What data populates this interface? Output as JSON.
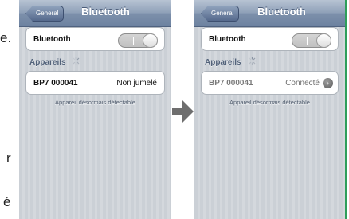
{
  "left_fragments": [
    "e.",
    "r",
    "é"
  ],
  "screens": [
    {
      "nav": {
        "back_label": "General",
        "title": "Bluetooth"
      },
      "bluetooth_row": {
        "label": "Bluetooth",
        "toggle_state": "on"
      },
      "devices_section": {
        "header": "Appareils"
      },
      "device": {
        "name": "BP7 000041",
        "status": "Non jumelé"
      },
      "footer_note": "Appareil désormais détectable"
    },
    {
      "nav": {
        "back_label": "General",
        "title": "Bluetooth"
      },
      "bluetooth_row": {
        "label": "Bluetooth",
        "toggle_state": "on"
      },
      "devices_section": {
        "header": "Appareils"
      },
      "device": {
        "name": "BP7 000041",
        "status": "Connecté",
        "info_icon": "chevron-right-icon"
      },
      "footer_note": "Appareil désormais détectable"
    }
  ],
  "arrow_icon": "arrow-right-icon",
  "colors": {
    "navbar": "#8d9fb7",
    "background_stripes": "#cbd0d6",
    "section_header": "#52627a",
    "accent_border": "#2e9e5a"
  }
}
